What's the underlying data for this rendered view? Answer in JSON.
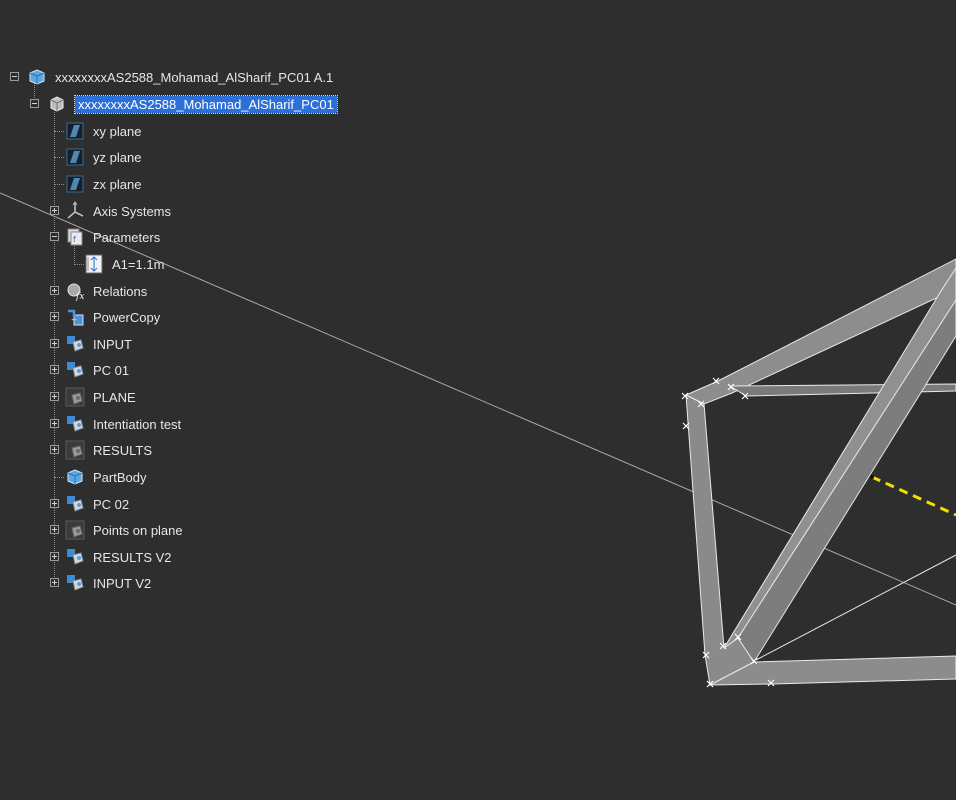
{
  "tree": {
    "root": {
      "label": "xxxxxxxxAS2588_Mohamad_AlSharif_PC01 A.1",
      "icon": "product-icon"
    },
    "part": {
      "label": "xxxxxxxxAS2588_Mohamad_AlSharif_PC01",
      "icon": "part-icon",
      "selected": true
    },
    "items": [
      {
        "id": "xy-plane",
        "label": "xy plane",
        "icon": "plane-icon",
        "expander": "none"
      },
      {
        "id": "yz-plane",
        "label": "yz plane",
        "icon": "plane-icon",
        "expander": "none"
      },
      {
        "id": "zx-plane",
        "label": "zx plane",
        "icon": "plane-icon",
        "expander": "none"
      },
      {
        "id": "axis-systems",
        "label": "Axis Systems",
        "icon": "axis-system-icon",
        "expander": "plus"
      },
      {
        "id": "parameters",
        "label": "Parameters",
        "icon": "parameters-icon",
        "expander": "minus"
      },
      {
        "id": "relations",
        "label": "Relations",
        "icon": "relations-icon",
        "expander": "plus"
      },
      {
        "id": "powercopy",
        "label": "PowerCopy",
        "icon": "powercopy-icon",
        "expander": "plus"
      },
      {
        "id": "input",
        "label": "INPUT",
        "icon": "geometrical-set-icon",
        "expander": "plus"
      },
      {
        "id": "pc01",
        "label": "PC 01",
        "icon": "geometrical-set-icon",
        "expander": "plus"
      },
      {
        "id": "plane",
        "label": "PLANE",
        "icon": "hidden-geometrical-set-icon",
        "expander": "plus"
      },
      {
        "id": "intentiation-test",
        "label": "Intentiation test",
        "icon": "geometrical-set-icon",
        "expander": "plus"
      },
      {
        "id": "results",
        "label": "RESULTS",
        "icon": "hidden-geometrical-set-icon",
        "expander": "plus"
      },
      {
        "id": "partbody",
        "label": "PartBody",
        "icon": "body-icon",
        "expander": "none"
      },
      {
        "id": "pc02",
        "label": "PC 02",
        "icon": "geometrical-set-icon",
        "expander": "plus"
      },
      {
        "id": "points-on-plane",
        "label": "Points on plane",
        "icon": "hidden-geometrical-set-icon",
        "expander": "plus"
      },
      {
        "id": "results-v2",
        "label": "RESULTS V2",
        "icon": "geometrical-set-icon",
        "expander": "plus"
      },
      {
        "id": "input-v2",
        "label": "INPUT V2",
        "icon": "geometrical-set-icon",
        "expander": "plus"
      }
    ],
    "parameter": {
      "label": "A1=1.1m",
      "icon": "length-parameter-icon"
    }
  },
  "colors": {
    "background": "#2e2e2e",
    "text": "#e6e6e6",
    "selection": "#2b6fd8",
    "beam": "#8c8c8c",
    "construction_line": "#f0e000"
  }
}
